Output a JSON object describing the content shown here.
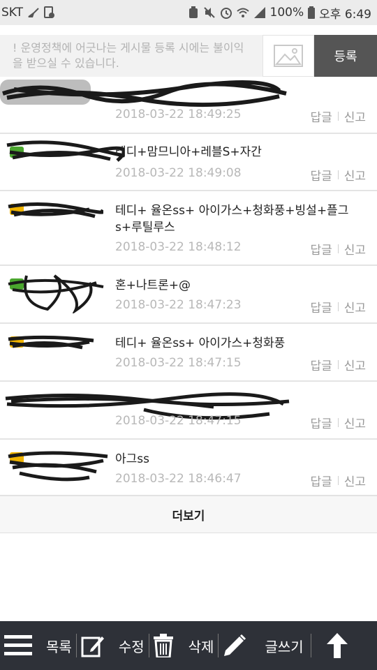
{
  "status_bar": {
    "carrier": "SKT",
    "battery": "100%",
    "time": "오후 6:49"
  },
  "composer": {
    "placeholder": "! 운영정책에 어긋나는 게시물 등록 시에는 불이익을 받으실 수 있습니다.",
    "submit_label": "등록"
  },
  "comments": [
    {
      "text": "",
      "date": "2018-03-22 18:49:25",
      "reply": "답글",
      "report": "신고"
    },
    {
      "text": "테디+맘므니아+레블S+자간",
      "date": "2018-03-22 18:49:08",
      "reply": "답글",
      "report": "신고"
    },
    {
      "text": "테디+ 율온ss+ 아이가스+청화풍+빙설+플그s+루틸루스",
      "date": "2018-03-22 18:48:12",
      "reply": "답글",
      "report": "신고"
    },
    {
      "text": "혼+나트론+@",
      "date": "2018-03-22 18:47:23",
      "reply": "답글",
      "report": "신고"
    },
    {
      "text": "테디+ 율온ss+ 아이가스+청화풍",
      "date": "2018-03-22 18:47:15",
      "reply": "답글",
      "report": "신고"
    },
    {
      "text": "",
      "date": "2018-03-22 18:47:15",
      "reply": "답글",
      "report": "신고"
    },
    {
      "text": "아그ss",
      "date": "2018-03-22 18:46:47",
      "reply": "답글",
      "report": "신고"
    }
  ],
  "more_label": "더보기",
  "bottom_bar": {
    "list_label": "목록",
    "edit_label": "수정",
    "delete_label": "삭제",
    "write_label": "글쓰기"
  },
  "colors": {
    "bottom_bar": "#2e3138",
    "submit_button": "#555555",
    "badge_green": "#4aa62e",
    "badge_yellow": "#f0b400"
  }
}
